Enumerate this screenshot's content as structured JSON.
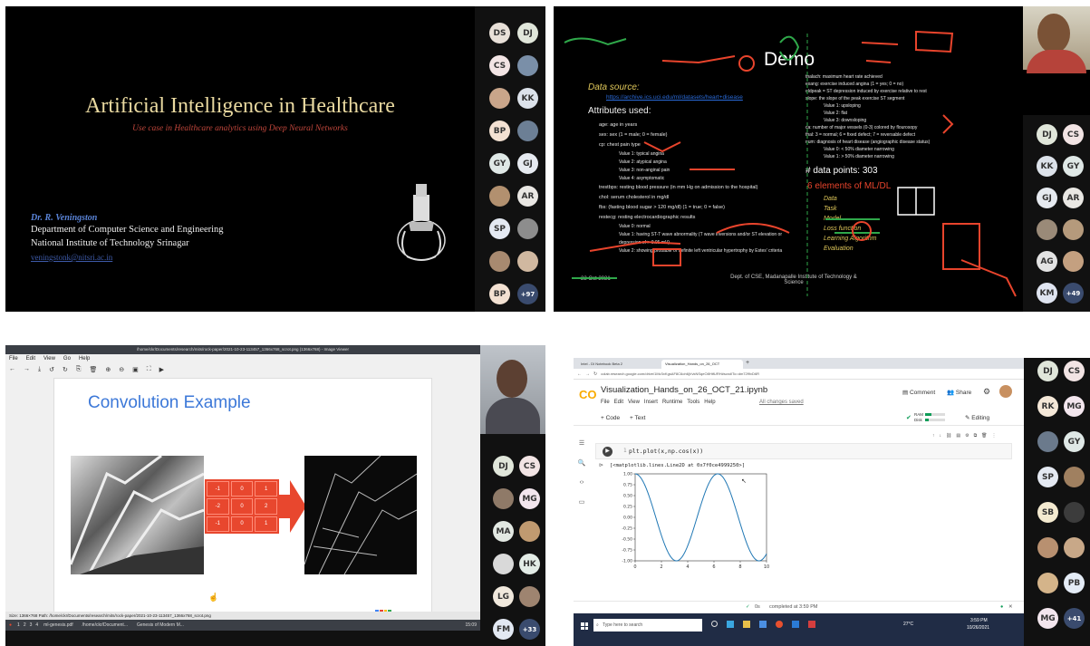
{
  "p1": {
    "title": "Artificial Intelligence in Healthcare",
    "subtitle": "Use case in Healthcare analytics using Deep Neural Networks",
    "author": "Dr. R. Veningston",
    "dept": "Department of Computer Science and Engineering",
    "inst": "National Institute of  Technology Srinagar",
    "email": "veningstonk@nitsri.ac.in",
    "participants": [
      {
        "initials": "DS",
        "color": "#e8e0d8"
      },
      {
        "initials": "DJ",
        "color": "#e0e6da"
      },
      {
        "initials": "CS",
        "color": "#f2e4e4"
      },
      {
        "initials": "",
        "color": "#7a8fa8"
      },
      {
        "initials": "",
        "color": "#c9a58a"
      },
      {
        "initials": "KK",
        "color": "#dce2ea"
      },
      {
        "initials": "BP",
        "color": "#f3e1d2"
      },
      {
        "initials": "",
        "color": "#6c7f95"
      },
      {
        "initials": "GY",
        "color": "#dfe8e6"
      },
      {
        "initials": "GJ",
        "color": "#e6eaf0"
      },
      {
        "initials": "",
        "color": "#b2906f"
      },
      {
        "initials": "AR",
        "color": "#e9e7e3"
      },
      {
        "initials": "SP",
        "color": "#e4e9f2"
      },
      {
        "initials": "",
        "color": "#8d8d8d"
      },
      {
        "initials": "",
        "color": "#a88a70"
      },
      {
        "initials": "",
        "color": "#d0b8a0"
      },
      {
        "initials": "BP",
        "color": "#f3e1d2"
      },
      {
        "initials": "+97",
        "color": "#3a4b6e"
      }
    ]
  },
  "p2": {
    "demo": "Demo",
    "data_source_label": "Data source:",
    "data_source_url": "https://archive.ics.uci.edu/ml/datasets/heart+disease",
    "attributes_label": "Attributes used:",
    "attributes": [
      "age: age in years",
      "sex: sex (1 = male; 0 = female)",
      "cp: chest pain type",
      "Value 1: typical angina",
      "Value 2: atypical angina",
      "Value 3: non-anginal pain",
      "Value 4: asymptomatic",
      "trestbps: resting blood pressure (in mm Hg on admission to the hospital)",
      "chol: serum cholesterol in mg/dl",
      "fbs: (fasting blood sugar > 120 mg/dl) (1 = true; 0 = false)",
      "restecg: resting electrocardiographic results",
      "Value 0: normal",
      "Value 1: having ST-T wave abnormality (T wave inversions and/or ST elevation or depression of > 0.05 mV)",
      "Value 2: showing probable or definite left ventricular hypertrophy by Estes' criteria"
    ],
    "right_attrs": [
      "thalach: maximum heart rate achieved",
      "exang: exercise induced angina (1 = yes; 0 = no)",
      "oldpeak = ST depression induced by exercise relative to rest",
      "slope: the slope of the peak exercise ST segment",
      "Value 1: upsloping",
      "Value 2: flat",
      "Value 3: downsloping",
      "ca: number of major vessels (0-3) colored by flourosopy",
      "thal: 3 = normal; 6 = fixed defect; 7 = reversable defect",
      "num: diagnosis of heart disease (angiographic disease status)",
      "Value 0: < 50% diameter narrowing",
      "Value 1: > 50% diameter narrowing"
    ],
    "datapoints": "# data points: 303",
    "elements_title": "6 elements of ML/DL",
    "elements": [
      "Data",
      "Task",
      "Model",
      "Loss function",
      "Learning Algorithm",
      "Evaluation"
    ],
    "date": "22 Oct 2021",
    "footer": "Dept. of CSE, Madanapalle Institute of Technology & Science",
    "participants": [
      {
        "initials": "DJ",
        "color": "#e0e6da"
      },
      {
        "initials": "CS",
        "color": "#f2e4e4"
      },
      {
        "initials": "KK",
        "color": "#dce2ea"
      },
      {
        "initials": "GY",
        "color": "#dfe8e6"
      },
      {
        "initials": "GJ",
        "color": "#e6eaf0"
      },
      {
        "initials": "AR",
        "color": "#e9e7e3"
      },
      {
        "initials": "",
        "color": "#9a8a78"
      },
      {
        "initials": "",
        "color": "#b59a7c"
      },
      {
        "initials": "AG",
        "color": "#e3e3e3"
      },
      {
        "initials": "",
        "color": "#c4a080"
      },
      {
        "initials": "KM",
        "color": "#dfe4f0"
      },
      {
        "initials": "+49",
        "color": "#3a4b6e"
      }
    ]
  },
  "p3": {
    "titlebar": "/home/ckr/Documents/research/mits/rock-paper/2021-10-23-113457_1366x768_scrot.png (1366x768) - Image Viewer",
    "menu": [
      "File",
      "Edit",
      "View",
      "Go",
      "Help"
    ],
    "slide_title": "Convolution Example",
    "kernel": [
      [
        "-1",
        "0",
        "1"
      ],
      [
        "-2",
        "0",
        "2"
      ],
      [
        "-1",
        "0",
        "1"
      ]
    ],
    "status": "Size: 1366×768   Path: /home/ckr/Documents/research/mits/rock-paper/2021-10-23-113457_1366x768_scrot.png",
    "task_items": [
      "ml-genesis.pdf",
      "/home/ckr/Document...",
      "Genesis of Modern M..."
    ],
    "ws_numbers": [
      "1",
      "2",
      "3",
      "4"
    ],
    "clock": "15:09",
    "participants": [
      {
        "initials": "DJ",
        "color": "#e0e6da"
      },
      {
        "initials": "CS",
        "color": "#f2e4e4"
      },
      {
        "initials": "",
        "color": "#8f7a68"
      },
      {
        "initials": "MG",
        "color": "#f3e6ee"
      },
      {
        "initials": "MA",
        "color": "#e2e8e2"
      },
      {
        "initials": "",
        "color": "#c09a70"
      },
      {
        "initials": "",
        "color": "#d9d9d9"
      },
      {
        "initials": "HK",
        "color": "#e3ece6"
      },
      {
        "initials": "LG",
        "color": "#f0e8dc"
      },
      {
        "initials": "",
        "color": "#9e8470"
      },
      {
        "initials": "FM",
        "color": "#e2e8f2"
      },
      {
        "initials": "+33",
        "color": "#3a4b6e"
      }
    ]
  },
  "p4": {
    "tabs": [
      "Intel - DI Notebook Beta 2",
      "Visualization_Hands_on_26_OCT"
    ],
    "url": "colab.research.google.com/drive/1Mv3xKgsAF8C6oh6jVvkNSqeO8HtfURH#scrollTo=dm72f9vD6R",
    "notebook": "Visualization_Hands_on_26_OCT_21.ipynb",
    "menu": [
      "File",
      "Edit",
      "View",
      "Insert",
      "Runtime",
      "Tools",
      "Help"
    ],
    "saved": "All changes saved",
    "comment": "Comment",
    "share": "Share",
    "code_btn": "+ Code",
    "text_btn": "+ Text",
    "ram": "RAM",
    "disk": "Disk",
    "editing": "Editing",
    "code": "plt.plot(x,np.cos(x))",
    "line_no": "1",
    "output": "[<matplotlib.lines.Line2D at 0x7f0ce4999250>]",
    "status": "completed at 3:59 PM",
    "exec_time": "0s",
    "taskbar_search": "Type here to search",
    "weather": "27°C",
    "clock": "3:59 PM",
    "date": "10/26/2021",
    "participants": [
      {
        "initials": "DJ",
        "color": "#e0e6da"
      },
      {
        "initials": "CS",
        "color": "#f2e4e4"
      },
      {
        "initials": "RK",
        "color": "#f5e8d8"
      },
      {
        "initials": "MG",
        "color": "#f3e6ee"
      },
      {
        "initials": "",
        "color": "#6b7a8c"
      },
      {
        "initials": "GY",
        "color": "#dfe8e6"
      },
      {
        "initials": "SP",
        "color": "#e4e9f2"
      },
      {
        "initials": "",
        "color": "#a08060"
      },
      {
        "initials": "SB",
        "color": "#f4ead0"
      },
      {
        "initials": "",
        "color": "#3c3c3c"
      },
      {
        "initials": "",
        "color": "#b89070"
      },
      {
        "initials": "",
        "color": "#c8a888"
      },
      {
        "initials": "",
        "color": "#d4b48a"
      },
      {
        "initials": "PB",
        "color": "#e4ecf6"
      },
      {
        "initials": "MG",
        "color": "#f3e6ee"
      },
      {
        "initials": "+41",
        "color": "#3a4b6e"
      }
    ]
  },
  "chart_data": {
    "type": "line",
    "title": "",
    "xlabel": "",
    "ylabel": "",
    "xlim": [
      0,
      10
    ],
    "ylim": [
      -1.0,
      1.0
    ],
    "x_ticks": [
      "0",
      "2",
      "4",
      "6",
      "8",
      "10"
    ],
    "y_ticks": [
      "1.00",
      "0.75",
      "0.50",
      "0.25",
      "0.00",
      "-0.25",
      "-0.50",
      "-0.75",
      "-1.00"
    ],
    "series": [
      {
        "function": "cos(x)",
        "x_range": [
          0,
          10
        ]
      }
    ]
  }
}
